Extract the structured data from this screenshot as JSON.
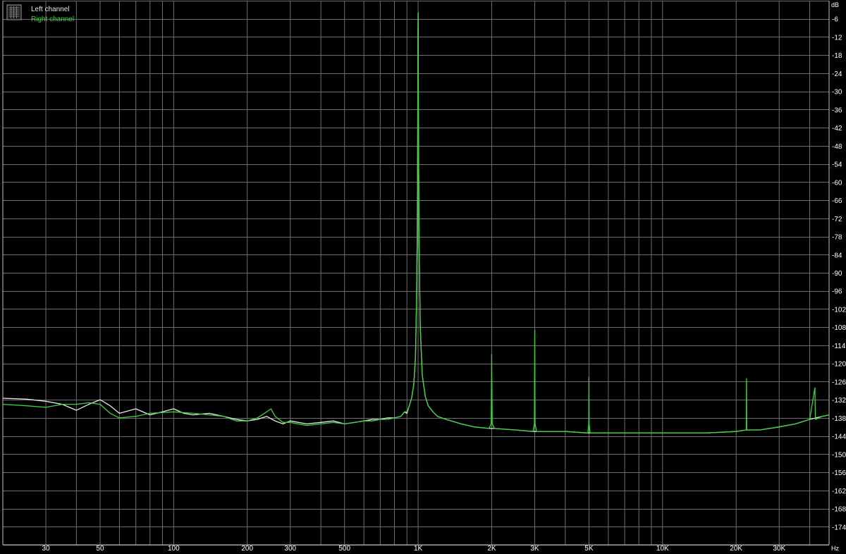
{
  "chart_data": {
    "type": "line",
    "title": "",
    "xlabel": "",
    "ylabel": "",
    "x_unit": "Hz",
    "y_unit": "dB",
    "x_scale": "log",
    "xlim": [
      20,
      48000
    ],
    "ylim": [
      -180,
      0
    ],
    "grid": true,
    "legend_position": "top-left",
    "colors": {
      "background": "#000000",
      "grid": "#6e6e6e",
      "axis": "#c0c0c0",
      "tick_text": "#ffffff"
    },
    "x_ticks": [
      {
        "v": 30,
        "label": "30"
      },
      {
        "v": 50,
        "label": "50"
      },
      {
        "v": 100,
        "label": "100"
      },
      {
        "v": 200,
        "label": "200"
      },
      {
        "v": 300,
        "label": "300"
      },
      {
        "v": 500,
        "label": "500"
      },
      {
        "v": 1000,
        "label": "1K"
      },
      {
        "v": 2000,
        "label": "2K"
      },
      {
        "v": 3000,
        "label": "3K"
      },
      {
        "v": 5000,
        "label": "5K"
      },
      {
        "v": 10000,
        "label": "10K"
      },
      {
        "v": 20000,
        "label": "20K"
      },
      {
        "v": 30000,
        "label": "30K"
      }
    ],
    "y_ticks": [
      -6,
      -12,
      -18,
      -24,
      -30,
      -36,
      -42,
      -48,
      -54,
      -60,
      -66,
      -72,
      -78,
      -84,
      -90,
      -96,
      -102,
      -108,
      -114,
      -120,
      -126,
      -132,
      -138,
      -144,
      -150,
      -156,
      -162,
      -168,
      -174
    ],
    "series": [
      {
        "name": "Left channel",
        "color": "#e8e8e8",
        "points": [
          [
            20,
            -131.5
          ],
          [
            25,
            -131.8
          ],
          [
            30,
            -132.5
          ],
          [
            35,
            -133.5
          ],
          [
            40,
            -135.5
          ],
          [
            45,
            -133.5
          ],
          [
            50,
            -132
          ],
          [
            55,
            -134
          ],
          [
            60,
            -136.5
          ],
          [
            70,
            -135
          ],
          [
            80,
            -137
          ],
          [
            90,
            -136
          ],
          [
            100,
            -135
          ],
          [
            110,
            -136.5
          ],
          [
            120,
            -137
          ],
          [
            140,
            -136.5
          ],
          [
            160,
            -137.5
          ],
          [
            180,
            -138.5
          ],
          [
            200,
            -139
          ],
          [
            220,
            -138.5
          ],
          [
            240,
            -137.5
          ],
          [
            260,
            -139
          ],
          [
            280,
            -140
          ],
          [
            300,
            -139
          ],
          [
            350,
            -140
          ],
          [
            400,
            -139.5
          ],
          [
            450,
            -139
          ],
          [
            500,
            -140
          ],
          [
            550,
            -139.5
          ],
          [
            600,
            -139
          ],
          [
            650,
            -138.5
          ],
          [
            700,
            -138.5
          ],
          [
            750,
            -138
          ],
          [
            800,
            -138
          ],
          [
            850,
            -137.5
          ],
          [
            880,
            -136
          ],
          [
            900,
            -136.5
          ],
          [
            920,
            -134
          ],
          [
            940,
            -131.5
          ],
          [
            960,
            -127
          ],
          [
            975,
            -118
          ],
          [
            985,
            -100
          ],
          [
            992,
            -75
          ],
          [
            996,
            -45
          ],
          [
            999,
            -10
          ],
          [
            1000,
            -4
          ],
          [
            1001,
            -12
          ],
          [
            1004,
            -50
          ],
          [
            1010,
            -82
          ],
          [
            1020,
            -108
          ],
          [
            1040,
            -124
          ],
          [
            1070,
            -131
          ],
          [
            1100,
            -134
          ],
          [
            1150,
            -136
          ],
          [
            1200,
            -137.5
          ],
          [
            1300,
            -138.5
          ],
          [
            1500,
            -140
          ],
          [
            1700,
            -141
          ],
          [
            1950,
            -141.5
          ],
          [
            2000,
            -141.5
          ],
          [
            2050,
            -141.5
          ],
          [
            2500,
            -142
          ],
          [
            2950,
            -142.5
          ],
          [
            3000,
            -142.5
          ],
          [
            3050,
            -142.5
          ],
          [
            4000,
            -142.5
          ],
          [
            4950,
            -143
          ],
          [
            5000,
            -143
          ],
          [
            5050,
            -143
          ],
          [
            7000,
            -143
          ],
          [
            10000,
            -143
          ],
          [
            15000,
            -143
          ],
          [
            20000,
            -142.5
          ],
          [
            22000,
            -142
          ],
          [
            22050,
            -142
          ],
          [
            25000,
            -142
          ],
          [
            30000,
            -141
          ],
          [
            35000,
            -140
          ],
          [
            40000,
            -138.5
          ],
          [
            45000,
            -137.5
          ],
          [
            48000,
            -137
          ]
        ]
      },
      {
        "name": "Right channel",
        "color": "#3fd13f",
        "points": [
          [
            20,
            -133.5
          ],
          [
            25,
            -134
          ],
          [
            30,
            -134.5
          ],
          [
            35,
            -133.5
          ],
          [
            40,
            -133.5
          ],
          [
            45,
            -133
          ],
          [
            50,
            -133.5
          ],
          [
            55,
            -136.5
          ],
          [
            60,
            -138
          ],
          [
            70,
            -137.5
          ],
          [
            80,
            -136.5
          ],
          [
            100,
            -136
          ],
          [
            120,
            -136.5
          ],
          [
            140,
            -137
          ],
          [
            160,
            -137.5
          ],
          [
            180,
            -139
          ],
          [
            200,
            -139
          ],
          [
            220,
            -138
          ],
          [
            240,
            -136
          ],
          [
            250,
            -135
          ],
          [
            260,
            -137.5
          ],
          [
            280,
            -139.5
          ],
          [
            300,
            -139.5
          ],
          [
            350,
            -140.5
          ],
          [
            400,
            -140
          ],
          [
            450,
            -139.5
          ],
          [
            500,
            -140
          ],
          [
            550,
            -139.5
          ],
          [
            600,
            -139
          ],
          [
            650,
            -139
          ],
          [
            700,
            -138.5
          ],
          [
            750,
            -138.5
          ],
          [
            800,
            -138
          ],
          [
            850,
            -137.5
          ],
          [
            880,
            -136
          ],
          [
            900,
            -136
          ],
          [
            920,
            -134
          ],
          [
            940,
            -131.5
          ],
          [
            960,
            -127
          ],
          [
            975,
            -118
          ],
          [
            985,
            -100
          ],
          [
            992,
            -75
          ],
          [
            996,
            -45
          ],
          [
            999,
            -10
          ],
          [
            1000,
            -4
          ],
          [
            1001,
            -12
          ],
          [
            1004,
            -50
          ],
          [
            1010,
            -82
          ],
          [
            1020,
            -108
          ],
          [
            1040,
            -124
          ],
          [
            1070,
            -131
          ],
          [
            1100,
            -134
          ],
          [
            1150,
            -136
          ],
          [
            1200,
            -137.5
          ],
          [
            1300,
            -138.5
          ],
          [
            1500,
            -140
          ],
          [
            1700,
            -141
          ],
          [
            1950,
            -141.5
          ],
          [
            1990,
            -140
          ],
          [
            2000,
            -117
          ],
          [
            2010,
            -140
          ],
          [
            2050,
            -141.5
          ],
          [
            2500,
            -142
          ],
          [
            2950,
            -142.5
          ],
          [
            2990,
            -140
          ],
          [
            3000,
            -109
          ],
          [
            3010,
            -140
          ],
          [
            3050,
            -142.5
          ],
          [
            4000,
            -142.5
          ],
          [
            4950,
            -143
          ],
          [
            4990,
            -140
          ],
          [
            5000,
            -124.5
          ],
          [
            5010,
            -140
          ],
          [
            5050,
            -143
          ],
          [
            7000,
            -143
          ],
          [
            10000,
            -143
          ],
          [
            15000,
            -143
          ],
          [
            20000,
            -142.5
          ],
          [
            22000,
            -142
          ],
          [
            22050,
            -125
          ],
          [
            22100,
            -142
          ],
          [
            25000,
            -142
          ],
          [
            30000,
            -141
          ],
          [
            35000,
            -140
          ],
          [
            40000,
            -138.5
          ],
          [
            42000,
            -128
          ],
          [
            42200,
            -138.5
          ],
          [
            45000,
            -137.5
          ],
          [
            48000,
            -137
          ]
        ]
      }
    ]
  }
}
